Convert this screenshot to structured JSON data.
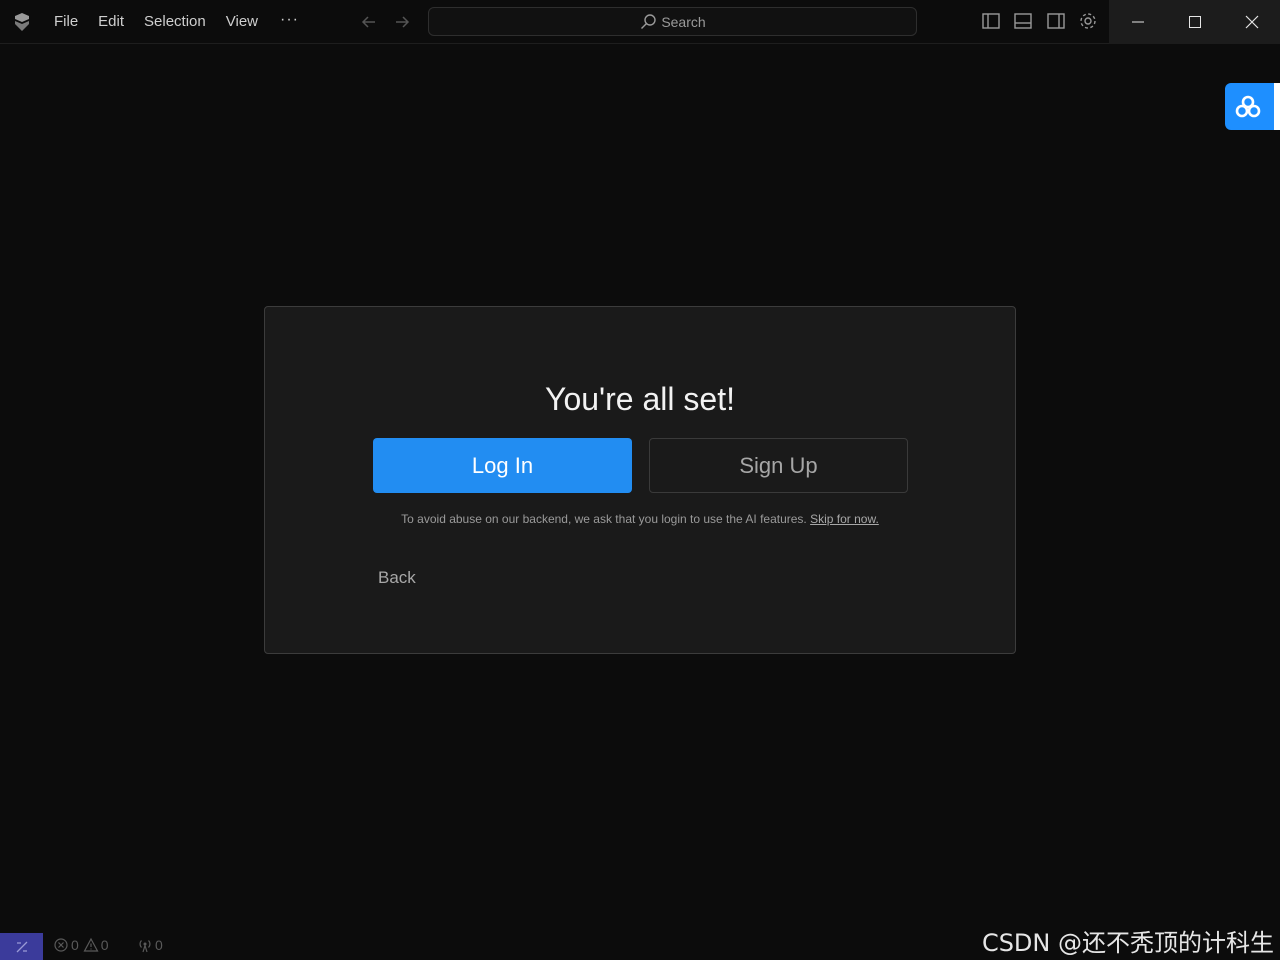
{
  "menu": {
    "items": [
      "File",
      "Edit",
      "Selection",
      "View"
    ],
    "more": "···"
  },
  "search": {
    "label": "Search"
  },
  "dialog": {
    "title": "You're all set!",
    "login_label": "Log In",
    "signup_label": "Sign Up",
    "notice_text": "To avoid abuse on our backend, we ask that you login to use the AI features. ",
    "skip_label": "Skip for now.",
    "back_label": "Back"
  },
  "status": {
    "errors": "0",
    "warnings": "0",
    "ports": "0"
  },
  "watermark": "CSDN @还不秃顶的计科生",
  "colors": {
    "accent": "#228df2",
    "background": "#0c0c0c",
    "dialog": "#1a1a1a",
    "remote": "#3b3b9b"
  }
}
